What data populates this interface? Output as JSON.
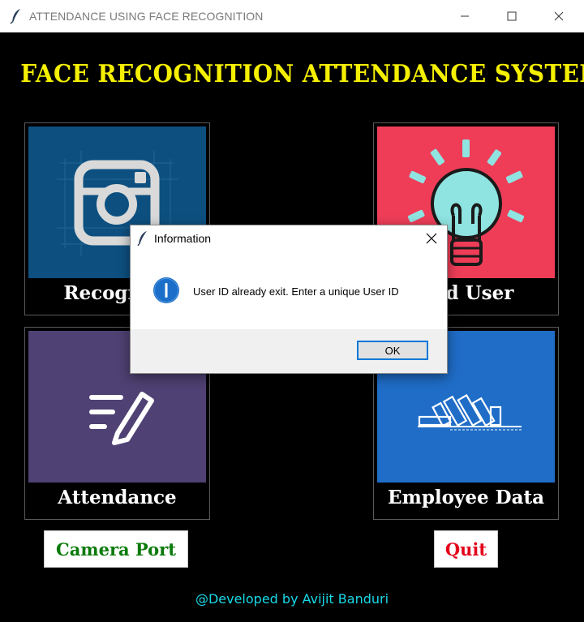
{
  "window": {
    "title": "ATTENDANCE USING FACE RECOGNITION",
    "minimize_icon": "minimize-icon",
    "maximize_icon": "maximize-icon",
    "close_icon": "close-icon"
  },
  "header": {
    "title": "FACE RECOGNITION ATTENDANCE SYSTEM"
  },
  "tiles": [
    {
      "label": "Recognize",
      "icon": "camera-icon",
      "bg": "#0d5080"
    },
    {
      "label": "Add User",
      "icon": "lightbulb-icon",
      "bg": "#ef3d58"
    },
    {
      "label": "Attendance",
      "icon": "edit-list-icon",
      "bg": "#4f4173"
    },
    {
      "label": "Employee Data",
      "icon": "books-icon",
      "bg": "#1f6dc7"
    }
  ],
  "buttons": {
    "camera_port": "Camera Port",
    "quit": "Quit"
  },
  "footer": {
    "credit": "@Developed by Avijit Banduri"
  },
  "dialog": {
    "title": "Information",
    "message": "User ID already exit. Enter a unique User ID",
    "ok_label": "OK",
    "icon": "info-icon"
  },
  "colors": {
    "title_yellow": "#f5f000",
    "camera_green": "#0a7a0a",
    "quit_red": "#e4001b",
    "footer_cyan": "#18d9e6",
    "dialog_accent": "#0078d7"
  }
}
